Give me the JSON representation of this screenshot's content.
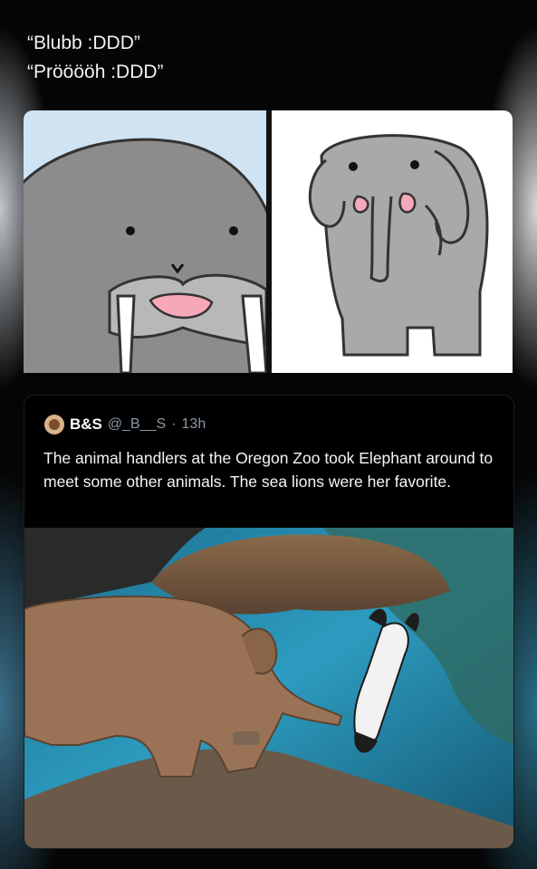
{
  "caption": {
    "line1": "“Blubb :DDD”",
    "line2": "“Prööööh :DDD”"
  },
  "tweet": {
    "author": "B&S",
    "handle": "@_B__S",
    "separator": "·",
    "time": "13h",
    "text": "The animal handlers at the Oregon Zoo took Elephant around to meet some other animals. The sea lions were her favorite."
  },
  "colors": {
    "background": "#0b0b0c",
    "walrus_bg": "#cfe3f3",
    "walrus_body": "#8c8c8c",
    "elephant_body": "#a9a9a9",
    "tongue": "#f7a8b8"
  }
}
